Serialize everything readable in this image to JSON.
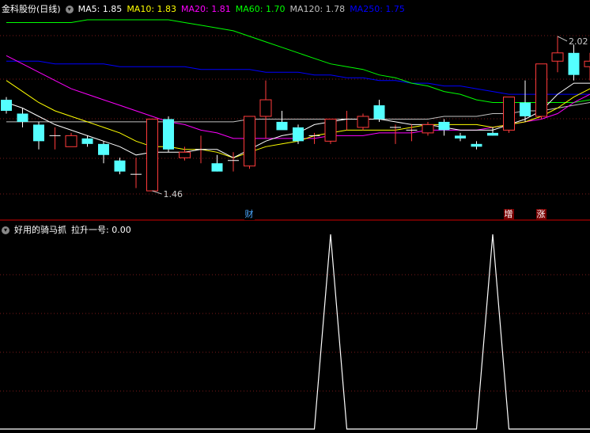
{
  "main_panel": {
    "stock_name": "金科股份(日线)",
    "ma_legend": [
      {
        "text": "MA5: 1.85",
        "color": "#ffffff"
      },
      {
        "text": "MA10: 1.83",
        "color": "#ffff00"
      },
      {
        "text": "MA20: 1.81",
        "color": "#ff00ff"
      },
      {
        "text": "MA60: 1.70",
        "color": "#00ff00"
      },
      {
        "text": "MA120: 1.78",
        "color": "#c0c0c0"
      },
      {
        "text": "MA250: 1.75",
        "color": "#0000ff"
      }
    ],
    "high_label": "2.02",
    "low_label": "1.46",
    "event_tags": [
      {
        "label": "财",
        "color": "#4aa8ff",
        "bar": 15
      },
      {
        "label": "增",
        "color": "#ff4444",
        "bar": 31
      },
      {
        "label": "涨",
        "color": "#ff4444",
        "bar": 33
      }
    ]
  },
  "sub_panel": {
    "indicator_name": "好用的骑马抓",
    "series_label": "拉升一号: 0.00"
  },
  "colors": {
    "up": "#ff3b3b",
    "down": "#54ffff",
    "grid": "#7a1a1a",
    "separator": "#8b0000"
  },
  "chart_data": [
    {
      "type": "candlestick",
      "title": "金科股份(日线)",
      "ylim": [
        1.4,
        2.1
      ],
      "candles": [
        {
          "o": 1.79,
          "h": 1.8,
          "l": 1.74,
          "c": 1.75
        },
        {
          "o": 1.74,
          "h": 1.76,
          "l": 1.69,
          "c": 1.71
        },
        {
          "o": 1.7,
          "h": 1.71,
          "l": 1.61,
          "c": 1.64
        },
        {
          "o": 1.66,
          "h": 1.69,
          "l": 1.61,
          "c": 1.66
        },
        {
          "o": 1.62,
          "h": 1.67,
          "l": 1.62,
          "c": 1.66
        },
        {
          "o": 1.65,
          "h": 1.66,
          "l": 1.62,
          "c": 1.63
        },
        {
          "o": 1.63,
          "h": 1.64,
          "l": 1.56,
          "c": 1.59
        },
        {
          "o": 1.57,
          "h": 1.58,
          "l": 1.52,
          "c": 1.53
        },
        {
          "o": 1.52,
          "h": 1.58,
          "l": 1.47,
          "c": 1.52
        },
        {
          "o": 1.46,
          "h": 1.72,
          "l": 1.46,
          "c": 1.72
        },
        {
          "o": 1.72,
          "h": 1.73,
          "l": 1.6,
          "c": 1.61
        },
        {
          "o": 1.58,
          "h": 1.62,
          "l": 1.57,
          "c": 1.6
        },
        {
          "o": 1.61,
          "h": 1.66,
          "l": 1.56,
          "c": 1.61
        },
        {
          "o": 1.56,
          "h": 1.59,
          "l": 1.53,
          "c": 1.53
        },
        {
          "o": 1.57,
          "h": 1.6,
          "l": 1.53,
          "c": 1.57
        },
        {
          "o": 1.55,
          "h": 1.73,
          "l": 1.54,
          "c": 1.73
        },
        {
          "o": 1.73,
          "h": 1.86,
          "l": 1.65,
          "c": 1.79
        },
        {
          "o": 1.71,
          "h": 1.75,
          "l": 1.69,
          "c": 1.68
        },
        {
          "o": 1.69,
          "h": 1.7,
          "l": 1.63,
          "c": 1.64
        },
        {
          "o": 1.66,
          "h": 1.67,
          "l": 1.63,
          "c": 1.66
        },
        {
          "o": 1.64,
          "h": 1.72,
          "l": 1.63,
          "c": 1.72
        },
        {
          "o": 1.72,
          "h": 1.75,
          "l": 1.68,
          "c": 1.72
        },
        {
          "o": 1.69,
          "h": 1.74,
          "l": 1.68,
          "c": 1.73
        },
        {
          "o": 1.77,
          "h": 1.79,
          "l": 1.71,
          "c": 1.72
        },
        {
          "o": 1.69,
          "h": 1.7,
          "l": 1.63,
          "c": 1.69
        },
        {
          "o": 1.68,
          "h": 1.7,
          "l": 1.64,
          "c": 1.68
        },
        {
          "o": 1.67,
          "h": 1.71,
          "l": 1.66,
          "c": 1.7
        },
        {
          "o": 1.71,
          "h": 1.72,
          "l": 1.66,
          "c": 1.68
        },
        {
          "o": 1.66,
          "h": 1.67,
          "l": 1.64,
          "c": 1.65
        },
        {
          "o": 1.63,
          "h": 1.64,
          "l": 1.61,
          "c": 1.62
        },
        {
          "o": 1.67,
          "h": 1.69,
          "l": 1.66,
          "c": 1.66
        },
        {
          "o": 1.68,
          "h": 1.8,
          "l": 1.67,
          "c": 1.8
        },
        {
          "o": 1.78,
          "h": 1.86,
          "l": 1.71,
          "c": 1.73
        },
        {
          "o": 1.73,
          "h": 1.92,
          "l": 1.72,
          "c": 1.92
        },
        {
          "o": 1.93,
          "h": 2.02,
          "l": 1.89,
          "c": 1.96
        },
        {
          "o": 1.96,
          "h": 1.99,
          "l": 1.86,
          "c": 1.88
        },
        {
          "o": 1.91,
          "h": 1.96,
          "l": 1.86,
          "c": 1.93
        }
      ],
      "ma": {
        "MA5": [
          1.78,
          1.76,
          1.73,
          1.7,
          1.68,
          1.66,
          1.64,
          1.62,
          1.59,
          1.6,
          1.6,
          1.6,
          1.61,
          1.61,
          1.58,
          1.61,
          1.64,
          1.66,
          1.67,
          1.7,
          1.71,
          1.72,
          1.72,
          1.72,
          1.71,
          1.7,
          1.7,
          1.69,
          1.68,
          1.68,
          1.68,
          1.7,
          1.72,
          1.75,
          1.81,
          1.85,
          1.85
        ],
        "MA10": [
          1.86,
          1.82,
          1.78,
          1.75,
          1.73,
          1.71,
          1.69,
          1.67,
          1.64,
          1.62,
          1.62,
          1.61,
          1.61,
          1.6,
          1.58,
          1.6,
          1.62,
          1.63,
          1.64,
          1.66,
          1.67,
          1.68,
          1.68,
          1.68,
          1.68,
          1.69,
          1.7,
          1.7,
          1.7,
          1.7,
          1.69,
          1.7,
          1.71,
          1.73,
          1.76,
          1.8,
          1.83
        ],
        "MA20": [
          1.95,
          1.92,
          1.89,
          1.86,
          1.83,
          1.81,
          1.79,
          1.77,
          1.75,
          1.73,
          1.71,
          1.7,
          1.68,
          1.67,
          1.65,
          1.65,
          1.65,
          1.65,
          1.65,
          1.65,
          1.66,
          1.66,
          1.66,
          1.67,
          1.67,
          1.67,
          1.68,
          1.68,
          1.68,
          1.68,
          1.69,
          1.7,
          1.71,
          1.72,
          1.74,
          1.78,
          1.81
        ],
        "MA60": [
          2.07,
          2.07,
          2.07,
          2.07,
          2.07,
          2.08,
          2.08,
          2.08,
          2.08,
          2.08,
          2.08,
          2.07,
          2.06,
          2.05,
          2.04,
          2.02,
          2.0,
          1.98,
          1.96,
          1.94,
          1.92,
          1.91,
          1.9,
          1.88,
          1.87,
          1.85,
          1.84,
          1.82,
          1.81,
          1.79,
          1.78,
          1.78,
          1.78,
          1.78,
          1.78,
          1.78,
          1.79
        ],
        "MA120": [
          1.71,
          1.71,
          1.71,
          1.71,
          1.71,
          1.71,
          1.71,
          1.71,
          1.71,
          1.71,
          1.71,
          1.71,
          1.71,
          1.71,
          1.71,
          1.72,
          1.72,
          1.72,
          1.72,
          1.72,
          1.72,
          1.72,
          1.72,
          1.72,
          1.72,
          1.72,
          1.72,
          1.73,
          1.73,
          1.73,
          1.74,
          1.74,
          1.75,
          1.75,
          1.76,
          1.77,
          1.78
        ],
        "MA250": [
          1.93,
          1.93,
          1.93,
          1.92,
          1.92,
          1.92,
          1.92,
          1.91,
          1.91,
          1.91,
          1.91,
          1.91,
          1.9,
          1.9,
          1.9,
          1.9,
          1.89,
          1.89,
          1.89,
          1.88,
          1.88,
          1.87,
          1.87,
          1.86,
          1.86,
          1.85,
          1.85,
          1.84,
          1.84,
          1.83,
          1.82,
          1.81,
          1.81,
          1.81,
          1.81,
          1.81,
          1.81
        ]
      }
    },
    {
      "type": "line",
      "title": "好用的骑马抓",
      "series": [
        {
          "name": "拉升一号",
          "color": "#ffffff",
          "values": [
            0,
            0,
            0,
            0,
            0,
            0,
            0,
            0,
            0,
            0,
            0,
            0,
            0,
            0,
            0,
            0,
            0,
            0,
            0,
            0,
            1,
            0,
            0,
            0,
            0,
            0,
            0,
            0,
            0,
            0,
            1,
            0,
            0,
            0,
            0,
            0,
            0
          ]
        }
      ],
      "ylim": [
        0,
        1
      ]
    }
  ]
}
